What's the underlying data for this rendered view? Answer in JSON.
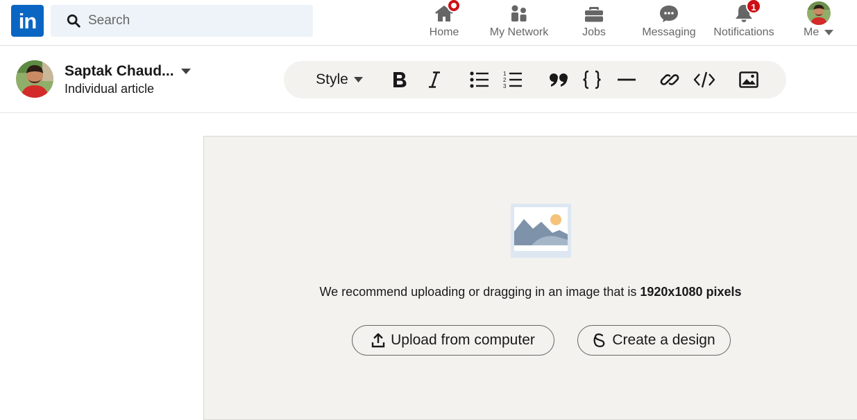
{
  "nav": {
    "logo_text": "in",
    "search_placeholder": "Search",
    "items": [
      {
        "label": "Home",
        "icon": "home-icon"
      },
      {
        "label": "My Network",
        "icon": "network-icon"
      },
      {
        "label": "Jobs",
        "icon": "briefcase-icon"
      },
      {
        "label": "Messaging",
        "icon": "messaging-icon"
      },
      {
        "label": "Notifications",
        "icon": "bell-icon",
        "badge": "1"
      },
      {
        "label": "Me",
        "icon": "avatar"
      }
    ]
  },
  "author": {
    "name": "Saptak Chaud...",
    "subtitle": "Individual article"
  },
  "toolbar": {
    "style_label": "Style",
    "icons": [
      "bold-icon",
      "italic-icon",
      "bulleted-list-icon",
      "numbered-list-icon",
      "quote-icon",
      "code-braces-icon",
      "divider-icon",
      "link-icon",
      "embed-code-icon",
      "image-icon"
    ]
  },
  "cover": {
    "recommend_prefix": "We recommend uploading or dragging in an image that is ",
    "recommend_size": "1920x1080 pixels",
    "upload_label": "Upload from computer",
    "design_label": "Create a design"
  },
  "colors": {
    "brand": "#0a66c2",
    "badge": "#cc1016",
    "canvas": "#f3f2ef",
    "search_bg": "#edf3f8"
  }
}
